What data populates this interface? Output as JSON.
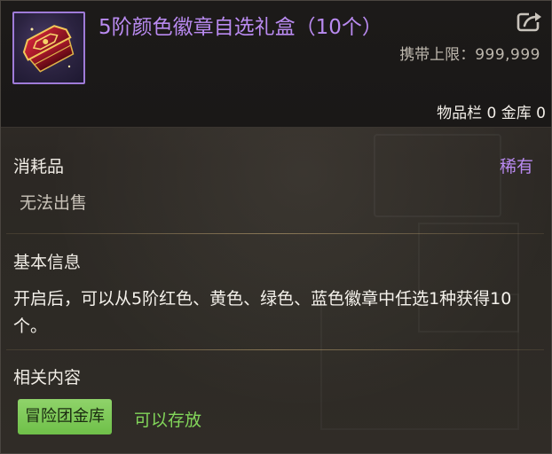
{
  "item": {
    "title": "5阶颜色徽章自选礼盒（10个）",
    "icon": "gift-box-icon",
    "title_color": "#b98af0",
    "icon_border_color": "#9f7bd8"
  },
  "header": {
    "share_icon": "share-export-icon",
    "carry_limit_label": "携带上限",
    "carry_limit_sep": "：",
    "carry_limit_value": "999,999",
    "storage_text": "物品栏 0 金库 0"
  },
  "details": {
    "type": "消耗品",
    "rarity": "稀有",
    "rarity_color": "#b98af0",
    "sell_note": "无法出售"
  },
  "basic_info": {
    "title": "基本信息",
    "description": "开启后，可以从5阶红色、黄色、绿色、蓝色徽章中任选1种获得10个。"
  },
  "related": {
    "title": "相关内容",
    "badge_label": "冒险团金库",
    "badge_color": "#7bc852",
    "note": "可以存放",
    "note_color": "#82d65a"
  }
}
